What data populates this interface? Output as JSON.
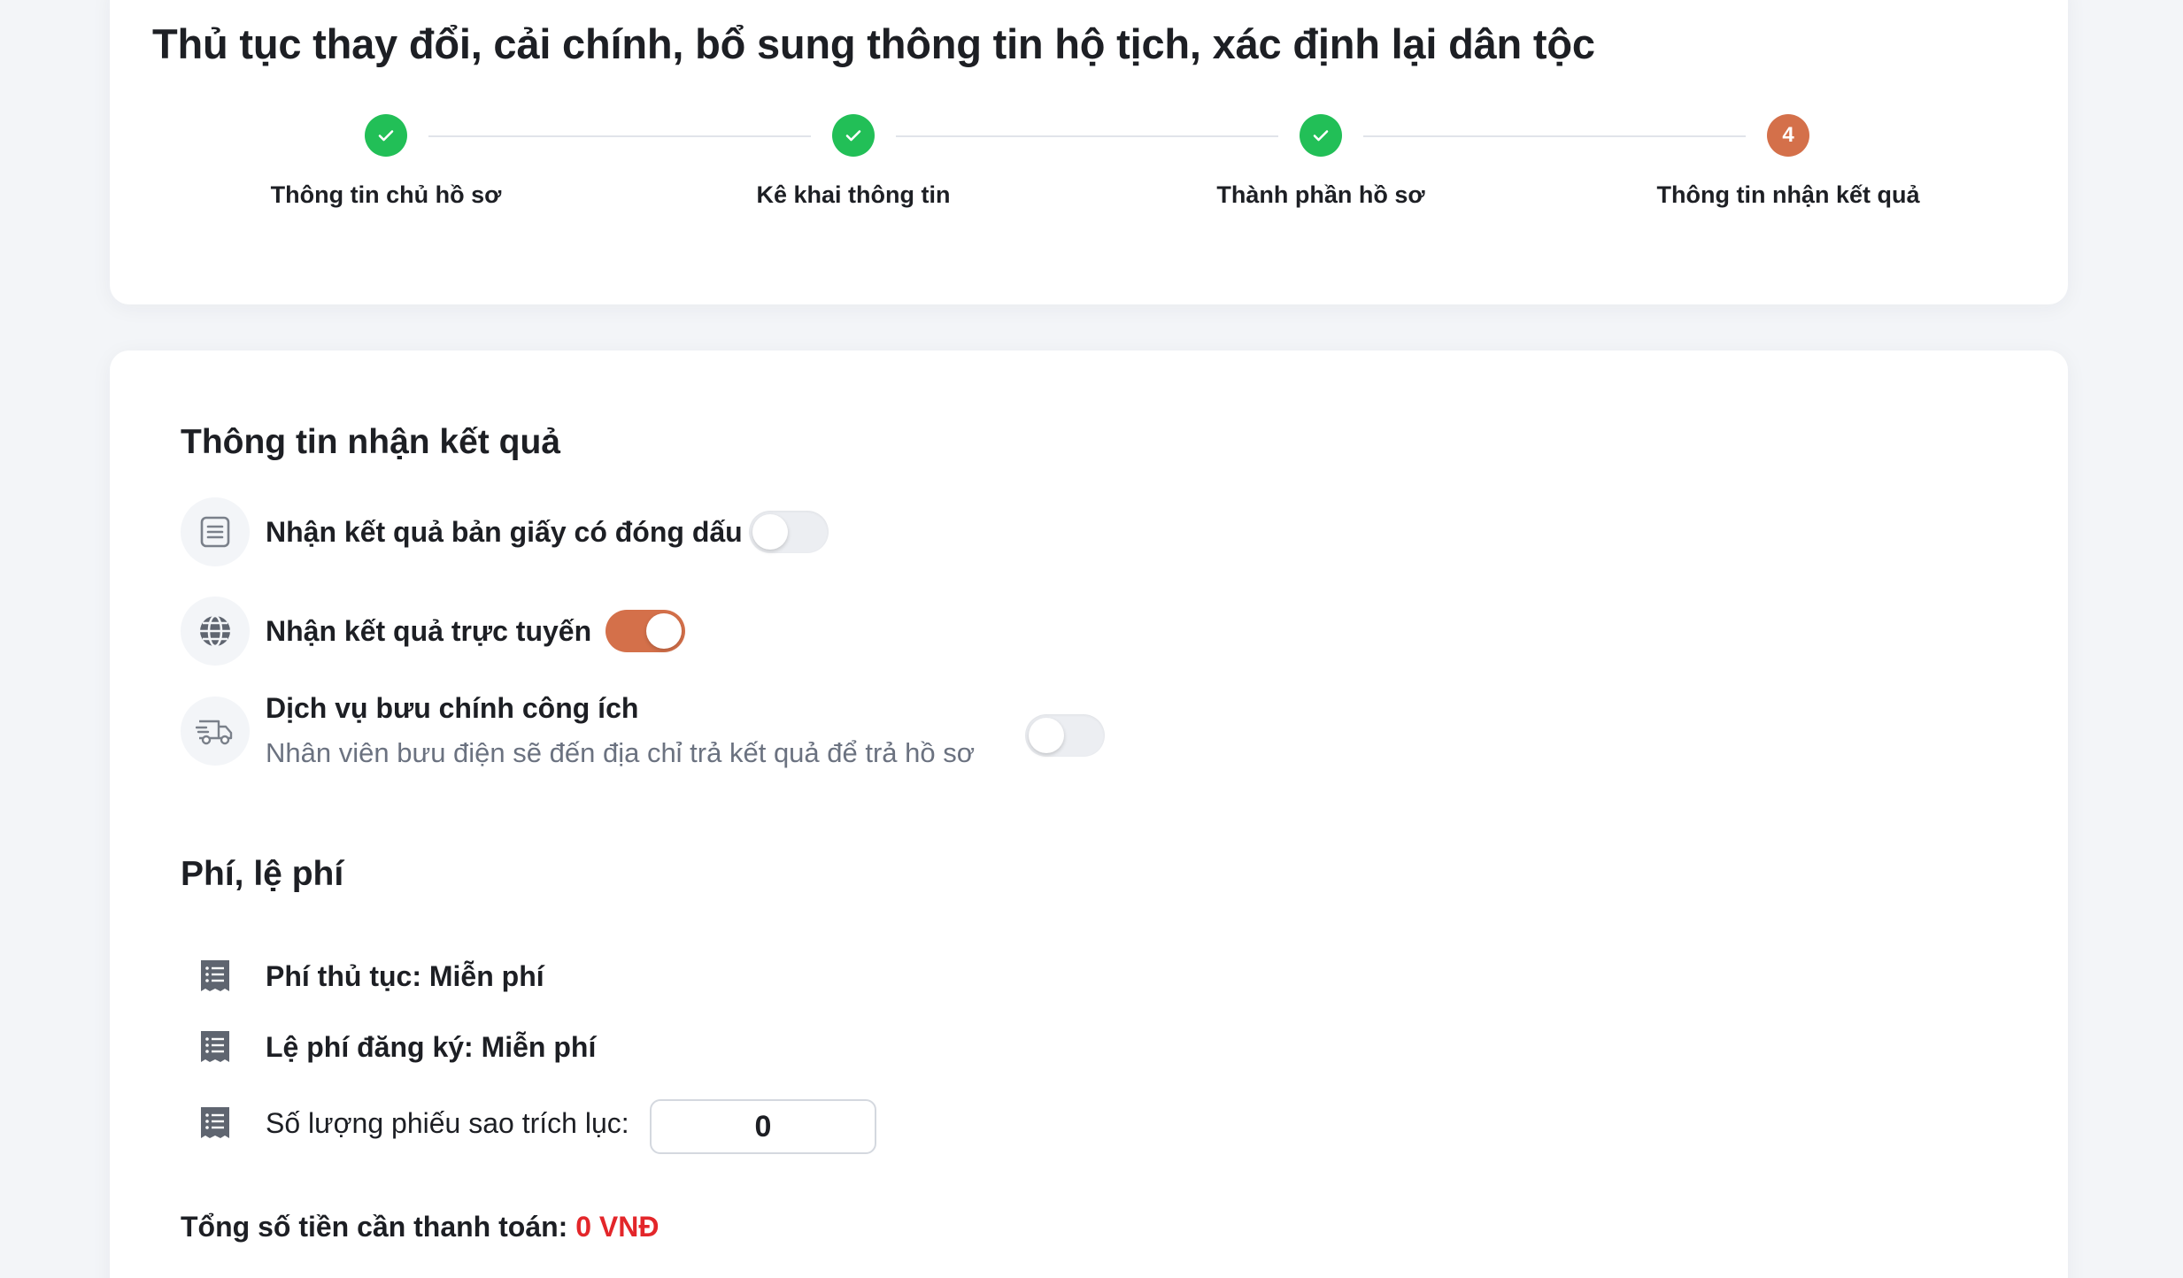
{
  "header": {
    "title": "Thủ tục thay đổi, cải chính, bổ sung thông tin hộ tịch, xác định lại dân tộc"
  },
  "stepper": {
    "steps": [
      {
        "label": "Thông tin chủ hồ sơ",
        "status": "done"
      },
      {
        "label": "Kê khai thông tin",
        "status": "done"
      },
      {
        "label": "Thành phần hồ sơ",
        "status": "done"
      },
      {
        "label": "Thông tin nhận kết quả",
        "status": "active",
        "number": "4"
      }
    ]
  },
  "receive": {
    "title": "Thông tin nhận kết quả",
    "options": [
      {
        "label": "Nhận kết quả bản giấy có đóng dấu",
        "icon": "document-icon",
        "enabled": false
      },
      {
        "label": "Nhận kết quả trực tuyến",
        "icon": "globe-icon",
        "enabled": true
      },
      {
        "label": "Dịch vụ bưu chính công ích",
        "sublabel": "Nhân viên bưu điện sẽ đến địa chỉ trả kết quả để trả hồ sơ",
        "icon": "delivery-truck-icon",
        "enabled": false
      }
    ]
  },
  "fees": {
    "title": "Phí, lệ phí",
    "items": [
      {
        "label": "Phí thủ tục: Miễn phí",
        "icon": "receipt-icon"
      },
      {
        "label": "Lệ phí đăng ký: Miễn phí",
        "icon": "receipt-icon"
      },
      {
        "label": "Số lượng phiếu sao trích lục:",
        "icon": "receipt-icon"
      }
    ],
    "copies_value": "0",
    "total_label": "Tổng số tiền cần thanh toán:",
    "total_amount": "0 VNĐ"
  },
  "colors": {
    "accent": "#d4704a",
    "success": "#22bf57",
    "total_amount": "#e3262a"
  }
}
